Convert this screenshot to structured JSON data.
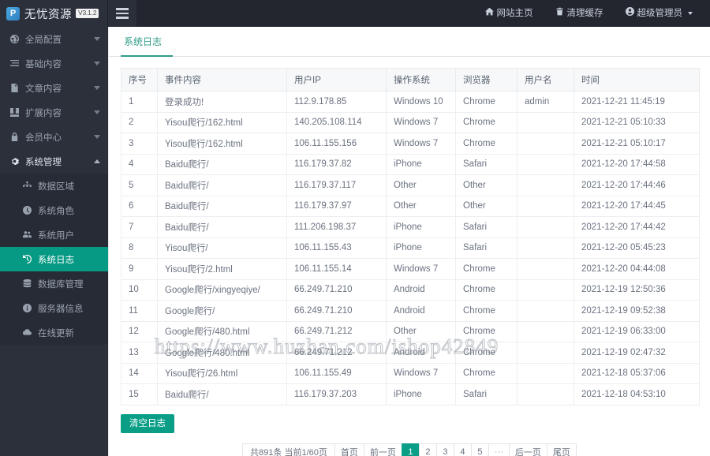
{
  "brand": {
    "logo_glyph": "P",
    "name": "无忧资源",
    "version": "V3.1.2"
  },
  "topbar": {
    "menu_toggle_icon": "hamburger-icon",
    "links": [
      {
        "label": "网站主页",
        "icon": "home-icon"
      },
      {
        "label": "清理缓存",
        "icon": "trash-icon"
      },
      {
        "label": "超级管理员",
        "icon": "user-circle-icon",
        "has_caret": true
      }
    ]
  },
  "sidebar": {
    "items": [
      {
        "label": "全局配置",
        "icon": "globe-icon",
        "expanded": false
      },
      {
        "label": "基础内容",
        "icon": "list-icon",
        "expanded": false
      },
      {
        "label": "文章内容",
        "icon": "document-icon",
        "expanded": false
      },
      {
        "label": "扩展内容",
        "icon": "puzzle-icon",
        "expanded": false
      },
      {
        "label": "会员中心",
        "icon": "lock-icon",
        "expanded": false
      },
      {
        "label": "系统管理",
        "icon": "gear-icon",
        "expanded": true
      }
    ],
    "submenu": [
      {
        "label": "数据区域",
        "icon": "sitemap-icon",
        "active": false
      },
      {
        "label": "系统角色",
        "icon": "clock-icon",
        "active": false
      },
      {
        "label": "系统用户",
        "icon": "users-icon",
        "active": false
      },
      {
        "label": "系统日志",
        "icon": "history-icon",
        "active": true
      },
      {
        "label": "数据库管理",
        "icon": "database-icon",
        "active": false
      },
      {
        "label": "服务器信息",
        "icon": "info-icon",
        "active": false
      },
      {
        "label": "在线更新",
        "icon": "cloud-icon",
        "active": false
      }
    ]
  },
  "main": {
    "tab_label": "系统日志",
    "clear_button": "清空日志",
    "columns": [
      "序号",
      "事件内容",
      "用户IP",
      "操作系统",
      "浏览器",
      "用户名",
      "时间"
    ],
    "rows": [
      [
        "1",
        "登录成功!",
        "112.9.178.85",
        "Windows 10",
        "Chrome",
        "admin",
        "2021-12-21 11:45:19"
      ],
      [
        "2",
        "Yisou爬行/162.html",
        "140.205.108.114",
        "Windows 7",
        "Chrome",
        "",
        "2021-12-21 05:10:33"
      ],
      [
        "3",
        "Yisou爬行/162.html",
        "106.11.155.156",
        "Windows 7",
        "Chrome",
        "",
        "2021-12-21 05:10:17"
      ],
      [
        "4",
        "Baidu爬行/",
        "116.179.37.82",
        "iPhone",
        "Safari",
        "",
        "2021-12-20 17:44:58"
      ],
      [
        "5",
        "Baidu爬行/",
        "116.179.37.117",
        "Other",
        "Other",
        "",
        "2021-12-20 17:44:46"
      ],
      [
        "6",
        "Baidu爬行/",
        "116.179.37.97",
        "Other",
        "Other",
        "",
        "2021-12-20 17:44:45"
      ],
      [
        "7",
        "Baidu爬行/",
        "111.206.198.37",
        "iPhone",
        "Safari",
        "",
        "2021-12-20 17:44:42"
      ],
      [
        "8",
        "Yisou爬行/",
        "106.11.155.43",
        "iPhone",
        "Safari",
        "",
        "2021-12-20 05:45:23"
      ],
      [
        "9",
        "Yisou爬行/2.html",
        "106.11.155.14",
        "Windows 7",
        "Chrome",
        "",
        "2021-12-20 04:44:08"
      ],
      [
        "10",
        "Google爬行/xingyeqiye/",
        "66.249.71.210",
        "Android",
        "Chrome",
        "",
        "2021-12-19 12:50:36"
      ],
      [
        "11",
        "Google爬行/",
        "66.249.71.210",
        "Android",
        "Chrome",
        "",
        "2021-12-19 09:52:38"
      ],
      [
        "12",
        "Google爬行/480.html",
        "66.249.71.212",
        "Other",
        "Chrome",
        "",
        "2021-12-19 06:33:00"
      ],
      [
        "13",
        "Google爬行/480.html",
        "66.249.71.212",
        "Android",
        "Chrome",
        "",
        "2021-12-19 02:47:32"
      ],
      [
        "14",
        "Yisou爬行/26.html",
        "106.11.155.49",
        "Windows 7",
        "Chrome",
        "",
        "2021-12-18 05:37:06"
      ],
      [
        "15",
        "Baidu爬行/",
        "116.179.37.203",
        "iPhone",
        "Safari",
        "",
        "2021-12-18 04:53:10"
      ]
    ]
  },
  "pagination": {
    "summary": "共891条 当前1/60页",
    "first": "首页",
    "prev": "前一页",
    "pages": [
      "1",
      "2",
      "3",
      "4",
      "5"
    ],
    "current": "1",
    "ellipsis": "···",
    "next": "后一页",
    "last": "尾页"
  },
  "watermark": {
    "text": "https://www.huzhan.com/ishop42849"
  },
  "colors": {
    "accent": "#0a9e87",
    "sidebar_bg": "#2b303b",
    "topbar_bg": "#23262e",
    "submenu_bg": "#272b35"
  }
}
